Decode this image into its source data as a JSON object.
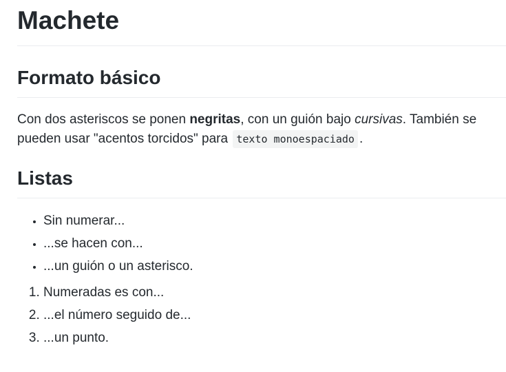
{
  "title": "Machete",
  "section_format": {
    "heading": "Formato básico",
    "text_1": "Con dos asteriscos se ponen ",
    "bold": "negritas",
    "text_2": ", con un guión bajo ",
    "italic": "cursivas",
    "text_3": ". También se pueden usar \"acentos torcidos\" para ",
    "code": "texto monoespaciado",
    "text_4": "."
  },
  "section_lists": {
    "heading": "Listas",
    "bullet_items": [
      "Sin numerar...",
      "...se hacen con...",
      "...un guión o un asterisco."
    ],
    "numbered_items": [
      "Numeradas es con...",
      "...el número seguido de...",
      "...un punto."
    ]
  }
}
